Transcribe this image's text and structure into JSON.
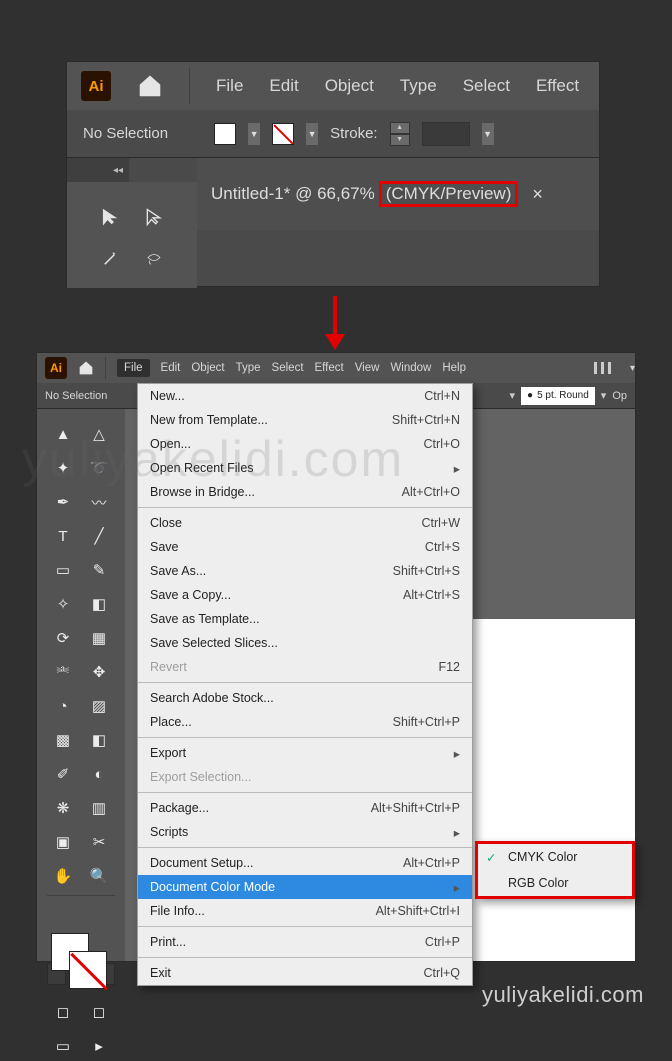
{
  "app": "Ai",
  "watermark": "yuliyakelidi.com",
  "watermark_big": "yuliyakelidi.com",
  "top": {
    "menus": [
      "File",
      "Edit",
      "Object",
      "Type",
      "Select",
      "Effect"
    ],
    "no_selection": "No Selection",
    "stroke_label": "Stroke:",
    "tab_pre": "Untitled-1* @ 66,67%",
    "tab_hl": "(CMYK/Preview)",
    "close": "×",
    "panel_head_caret": "◂◂"
  },
  "bot": {
    "menus": [
      "File",
      "Edit",
      "Object",
      "Type",
      "Select",
      "Effect",
      "View",
      "Window",
      "Help"
    ],
    "no_selection": "No Selection",
    "brush": "5 pt. Round",
    "opacity_lbl": "Op",
    "file_menu": [
      [
        {
          "lbl": "New...",
          "sc": "Ctrl+N"
        },
        {
          "lbl": "New from Template...",
          "sc": "Shift+Ctrl+N"
        },
        {
          "lbl": "Open...",
          "sc": "Ctrl+O"
        },
        {
          "lbl": "Open Recent Files",
          "sub": "▸"
        },
        {
          "lbl": "Browse in Bridge...",
          "sc": "Alt+Ctrl+O"
        }
      ],
      [
        {
          "lbl": "Close",
          "sc": "Ctrl+W"
        },
        {
          "lbl": "Save",
          "sc": "Ctrl+S"
        },
        {
          "lbl": "Save As...",
          "sc": "Shift+Ctrl+S"
        },
        {
          "lbl": "Save a Copy...",
          "sc": "Alt+Ctrl+S"
        },
        {
          "lbl": "Save as Template..."
        },
        {
          "lbl": "Save Selected Slices..."
        },
        {
          "lbl": "Revert",
          "sc": "F12",
          "dis": true
        }
      ],
      [
        {
          "lbl": "Search Adobe Stock..."
        },
        {
          "lbl": "Place...",
          "sc": "Shift+Ctrl+P"
        }
      ],
      [
        {
          "lbl": "Export",
          "sub": "▸"
        },
        {
          "lbl": "Export Selection...",
          "dis": true
        }
      ],
      [
        {
          "lbl": "Package...",
          "sc": "Alt+Shift+Ctrl+P"
        },
        {
          "lbl": "Scripts",
          "sub": "▸"
        }
      ],
      [
        {
          "lbl": "Document Setup...",
          "sc": "Alt+Ctrl+P"
        },
        {
          "lbl": "Document Color Mode",
          "sub": "▸",
          "hover": true
        },
        {
          "lbl": "File Info...",
          "sc": "Alt+Shift+Ctrl+I"
        }
      ],
      [
        {
          "lbl": "Print...",
          "sc": "Ctrl+P"
        }
      ],
      [
        {
          "lbl": "Exit",
          "sc": "Ctrl+Q"
        }
      ]
    ],
    "submenu": [
      {
        "lbl": "CMYK Color",
        "checked": true
      },
      {
        "lbl": "RGB Color"
      }
    ]
  }
}
